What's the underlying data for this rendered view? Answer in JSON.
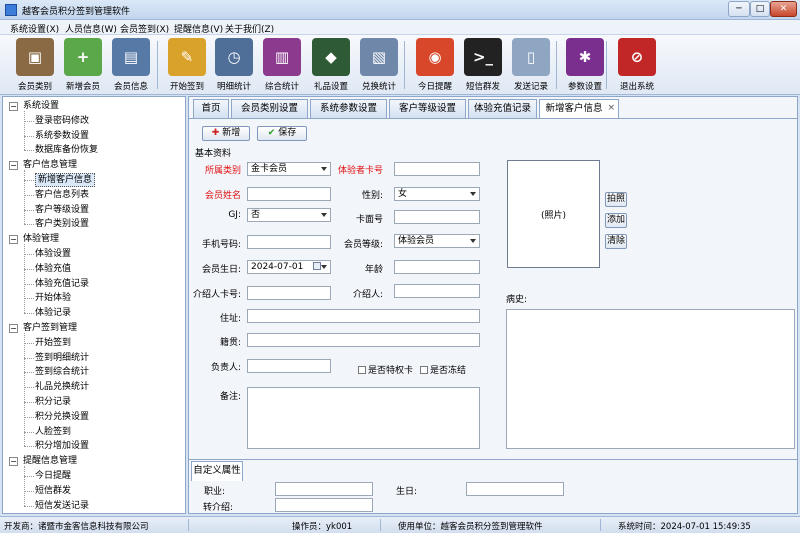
{
  "window": {
    "title": "越客会员积分签到管理软件",
    "min": "─",
    "max": "□",
    "close": "✕"
  },
  "menu": [
    "系统设置(X)",
    "人员信息(W)",
    "会员签到(X)",
    "提醒信息(V)",
    "关于我们(Z)"
  ],
  "toolbar": [
    {
      "label": "会员类别",
      "icon": "member-type-icon",
      "color": "#8a6a44",
      "glyph": "▣"
    },
    {
      "label": "新增会员",
      "icon": "add-member-icon",
      "color": "#5aa84a",
      "glyph": "+"
    },
    {
      "label": "会员信息",
      "icon": "member-info-icon",
      "color": "#5779a6",
      "glyph": "▤"
    },
    {
      "label": "开始签到",
      "icon": "pencils-icon",
      "color": "#d9a22b",
      "glyph": "✎"
    },
    {
      "label": "明细统计",
      "icon": "history-icon",
      "color": "#4f6f98",
      "glyph": "◷"
    },
    {
      "label": "综合统计",
      "icon": "chart-icon",
      "color": "#8b3a8e",
      "glyph": "▥"
    },
    {
      "label": "礼品设置",
      "icon": "evernote-icon",
      "color": "#2e5a35",
      "glyph": "◆"
    },
    {
      "label": "兑换统计",
      "icon": "folder-photo-icon",
      "color": "#6f87a9",
      "glyph": "▧"
    },
    {
      "label": "今日提醒",
      "icon": "chrome-icon",
      "color": "#d9472b",
      "glyph": "◉"
    },
    {
      "label": "短信群发",
      "icon": "terminal-icon",
      "color": "#222222",
      "glyph": ">_"
    },
    {
      "label": "发送记录",
      "icon": "document-icon",
      "color": "#8fa6c2",
      "glyph": "▯"
    },
    {
      "label": "参数设置",
      "icon": "gear-icon",
      "color": "#7a2f8f",
      "glyph": "✱"
    },
    {
      "label": "退出系统",
      "icon": "exit-icon",
      "color": "#c22727",
      "glyph": "⊘"
    }
  ],
  "tree": [
    {
      "label": "系统设置",
      "level": 0
    },
    {
      "label": "登录密码修改",
      "level": 1
    },
    {
      "label": "系统参数设置",
      "level": 1
    },
    {
      "label": "数据库备份恢复",
      "level": 1
    },
    {
      "label": "客户信息管理",
      "level": 0
    },
    {
      "label": "新增客户信息",
      "level": 1,
      "selected": true
    },
    {
      "label": "客户信息列表",
      "level": 1
    },
    {
      "label": "客户等级设置",
      "level": 1
    },
    {
      "label": "客户类别设置",
      "level": 1
    },
    {
      "label": "体验管理",
      "level": 0
    },
    {
      "label": "体验设置",
      "level": 1
    },
    {
      "label": "体验充值",
      "level": 1
    },
    {
      "label": "体验充值记录",
      "level": 1
    },
    {
      "label": "开始体验",
      "level": 1
    },
    {
      "label": "体验记录",
      "level": 1
    },
    {
      "label": "客户签到管理",
      "level": 0
    },
    {
      "label": "开始签到",
      "level": 1
    },
    {
      "label": "签到明细统计",
      "level": 1
    },
    {
      "label": "签到综合统计",
      "level": 1
    },
    {
      "label": "礼品兑换统计",
      "level": 1
    },
    {
      "label": "积分记录",
      "level": 1
    },
    {
      "label": "积分兑换设置",
      "level": 1
    },
    {
      "label": "人脸签到",
      "level": 1
    },
    {
      "label": "积分增加设置",
      "level": 1
    },
    {
      "label": "提醒信息管理",
      "level": 0
    },
    {
      "label": "今日提醒",
      "level": 1
    },
    {
      "label": "短信群发",
      "level": 1
    },
    {
      "label": "短信发送记录",
      "level": 1
    }
  ],
  "tabs": [
    {
      "label": "首页"
    },
    {
      "label": "会员类别设置"
    },
    {
      "label": "系统参数设置"
    },
    {
      "label": "客户等级设置"
    },
    {
      "label": "体验充值记录"
    },
    {
      "label": "新增客户信息",
      "active": true
    }
  ],
  "actions": {
    "new": "新增",
    "save": "保存"
  },
  "form": {
    "section": "基本资料",
    "category_label": "所属类别",
    "category_value": "金卡会员",
    "card_label": "体验者卡号",
    "card_value": "",
    "name_label": "会员姓名",
    "name_value": "",
    "gender_label": "性别:",
    "gender_value": "女",
    "gj_label": "GJ:",
    "gj_value": "否",
    "cardface_label": "卡面号",
    "cardface_value": "",
    "phone_label": "手机号码:",
    "phone_value": "",
    "level_label": "会员等级:",
    "level_value": "体验会员",
    "birthday_label": "会员生日:",
    "birthday_value": "2024-07-01",
    "age_label": "年龄",
    "age_value": "",
    "ref_card_label": "介绍人卡号:",
    "ref_card_value": "",
    "referrer_label": "介绍人:",
    "referrer_value": "",
    "address_label": "住址:",
    "address_value": "",
    "origin_label": "籍贯:",
    "origin_value": "",
    "manager_label": "负责人:",
    "manager_value": "",
    "privilege_label": "是否特权卡",
    "frozen_label": "是否冻结",
    "remark_label": "备注:",
    "photo_placeholder": "(照片)",
    "photo_btn_capture": "拍照",
    "photo_btn_add": "添加",
    "photo_btn_clear": "清除",
    "history_label": "病史:"
  },
  "custom": {
    "tab": "自定义属性",
    "job_label": "职业:",
    "job_value": "",
    "birth_label": "生日:",
    "birth_value": "",
    "intro_label": "转介绍:",
    "intro_value": ""
  },
  "status": {
    "developer": "开发商：诸暨市金客信息科技有限公司",
    "operator": "操作员：yk001",
    "unit": "使用单位：越客会员积分签到管理软件",
    "time": "系统时间：2024-07-01 15:49:35"
  }
}
